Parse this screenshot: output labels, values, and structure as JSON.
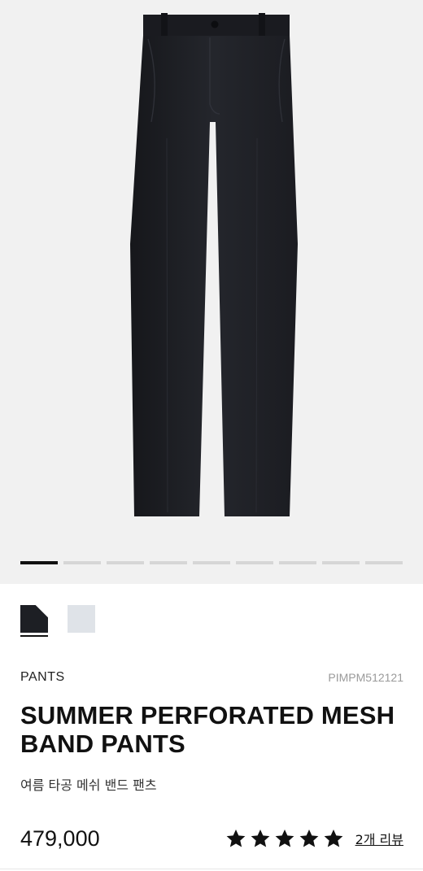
{
  "gallery": {
    "image_alt": "product-photo-black-pants",
    "slide_count": 9,
    "active_slide": 1
  },
  "swatches": [
    {
      "name": "black",
      "color": "#1d1f24",
      "selected": true
    },
    {
      "name": "light-grey",
      "color": "#dfe3e8",
      "selected": false
    }
  ],
  "product": {
    "category": "PANTS",
    "sku": "PIMPM512121",
    "title": "SUMMER PERFORATED MESH BAND PANTS",
    "subtitle": "여름 타공 메쉬 밴드 팬츠",
    "price": "479,000",
    "rating": 5,
    "review_link": "2개 리뷰"
  },
  "colors": {
    "pants": "#1c1d22",
    "background": "#f1f1f1",
    "pager_inactive": "#d6d6d6",
    "pager_active": "#111111"
  }
}
